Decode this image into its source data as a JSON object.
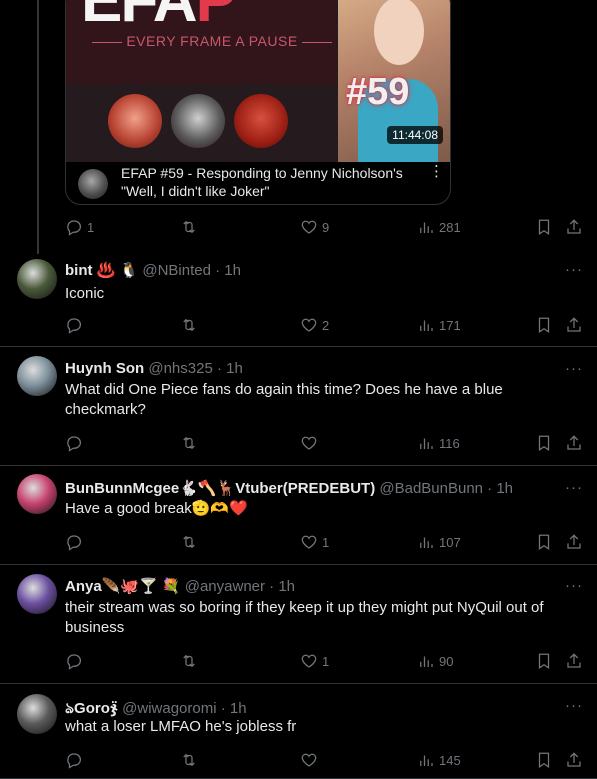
{
  "quoted_card": {
    "logo_text_white": "EFA",
    "logo_text_red": "P",
    "tagline": "EVERY FRAME A PAUSE",
    "episode_badge": "#59",
    "duration": "11:44:08",
    "video_title": "EFAP #59 - Responding to Jenny Nicholson's \"Well, I didn't like Joker\"",
    "menu_glyph": "⋮"
  },
  "top_actions": {
    "replies": "1",
    "retweets": "",
    "likes": "9",
    "views": "281"
  },
  "tweets": [
    {
      "name": "bint ♨️ 🐧",
      "handle": "@NBinted · 1h",
      "text": "Iconic",
      "replies": "",
      "retweets": "",
      "likes": "2",
      "views": "171",
      "avatar_color": "#4b5a3a"
    },
    {
      "name": "Huynh Son",
      "handle": "@nhs325 · 1h",
      "text": "What did One Piece fans do again this time? Does he have a blue checkmark?",
      "replies": "",
      "retweets": "",
      "likes": "",
      "views": "116",
      "avatar_color": "#7c8f9a"
    },
    {
      "name": "BunBunnMcgee🐇🪓🦌Vtuber(PREDEBUT)",
      "handle": "@BadBunBunn · 1h",
      "text": "Have a good break🫡🫶❤️",
      "replies": "",
      "retweets": "",
      "likes": "1",
      "views": "107",
      "avatar_color": "#c7436f"
    },
    {
      "name": "Anya🪶🐙🍸 💐",
      "handle": "@anyawner · 1h",
      "text": "their stream was so boring if they keep it up they might put NyQuil out of business",
      "replies": "",
      "retweets": "",
      "likes": "1",
      "views": "90",
      "avatar_color": "#6b4fa0"
    },
    {
      "name": "ঌGoroჯ̈",
      "handle": "@wiwagoromi · 1h",
      "text": "what a loser LMFAO he's jobless fr",
      "replies": "",
      "retweets": "",
      "likes": "",
      "views": "145",
      "avatar_color": "#5a5a5a"
    }
  ],
  "icons": {
    "reply": "reply-icon",
    "retweet": "retweet-icon",
    "like": "heart-icon",
    "views": "views-icon",
    "bookmark": "bookmark-icon",
    "share": "share-icon",
    "more": "more-icon"
  },
  "more_glyph": "···"
}
